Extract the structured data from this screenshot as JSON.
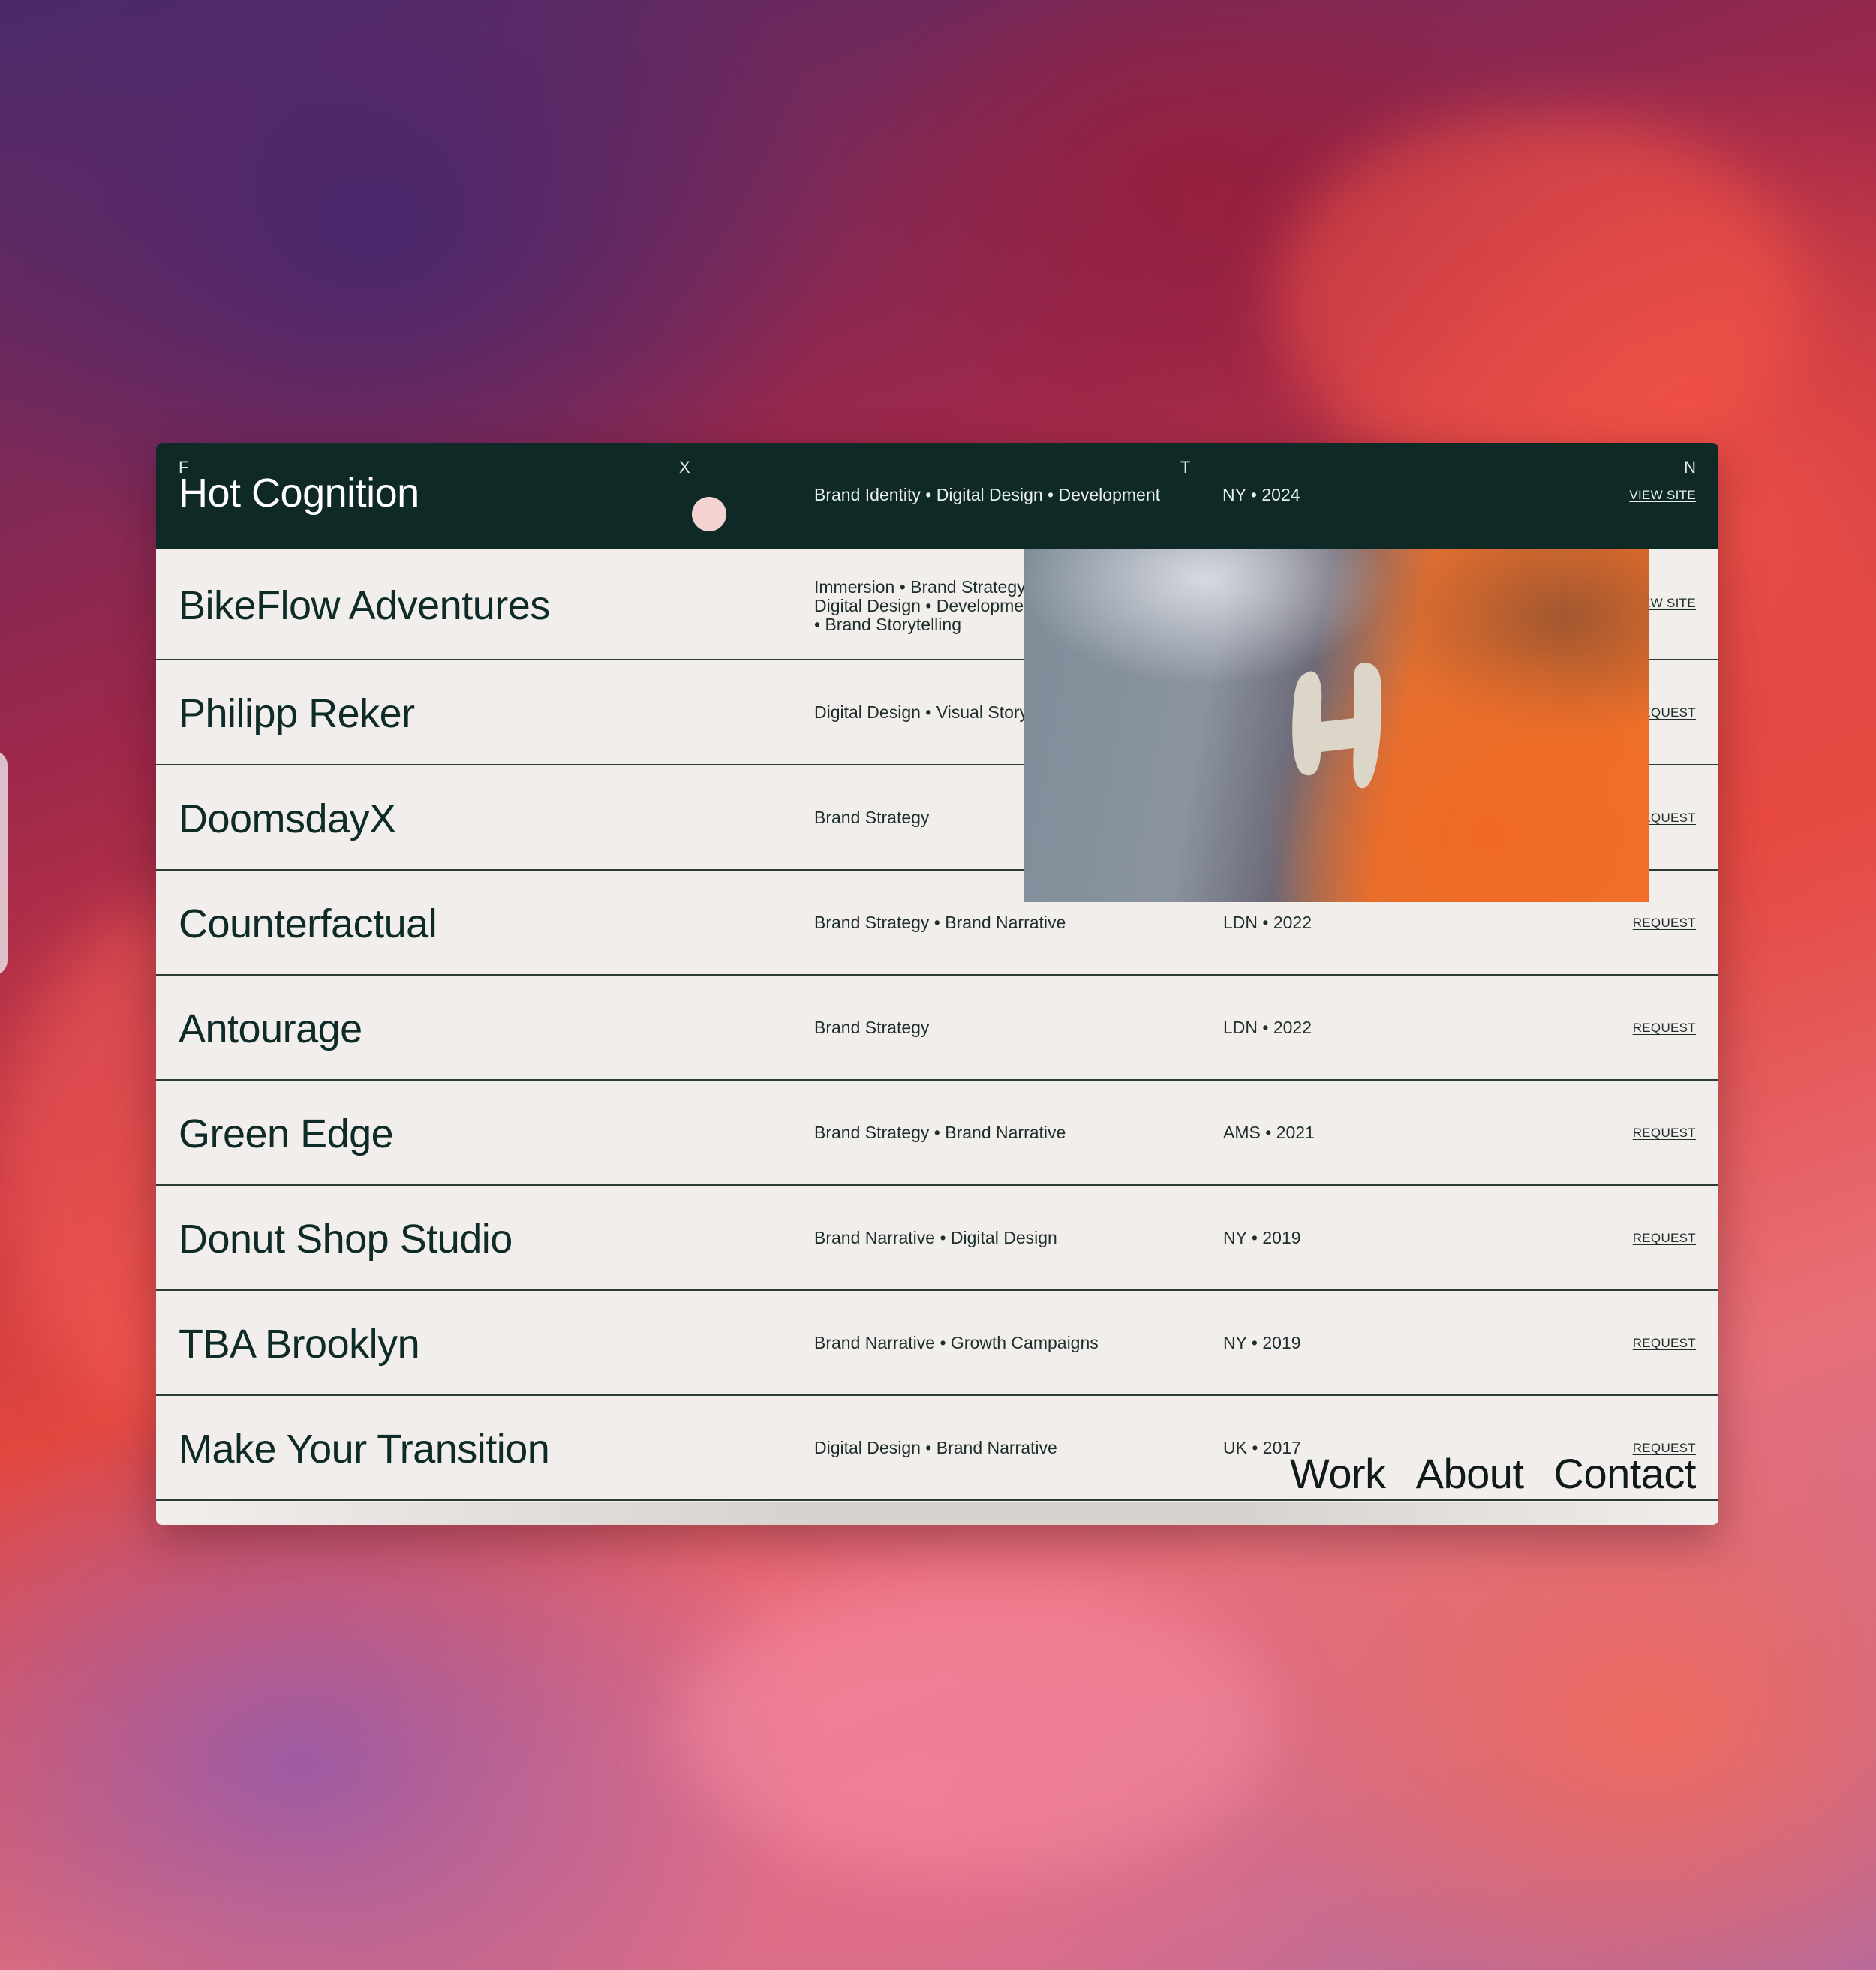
{
  "columns": {
    "a": "F",
    "b": "X",
    "c": "T",
    "d": "N"
  },
  "header_row": {
    "name": "Hot Cognition",
    "services": "Brand Identity • Digital Design • Development",
    "location": "NY • 2024",
    "action": "VIEW SITE"
  },
  "rows": [
    {
      "name": "BikeFlow Adventures",
      "services": "Immersion • Brand Strategy • Digital Design • Development • Brand Storytelling",
      "location": "",
      "action": "VIEW SITE"
    },
    {
      "name": "Philipp Reker",
      "services": "Digital Design • Visual Storytelling",
      "location": "",
      "action": "REQUEST"
    },
    {
      "name": "DoomsdayX",
      "services": "Brand Strategy",
      "location": "",
      "action": "REQUEST"
    },
    {
      "name": "Counterfactual",
      "services": "Brand Strategy • Brand Narrative",
      "location": "LDN • 2022",
      "action": "REQUEST"
    },
    {
      "name": "Antourage",
      "services": "Brand Strategy",
      "location": "LDN • 2022",
      "action": "REQUEST"
    },
    {
      "name": "Green Edge",
      "services": "Brand Strategy • Brand Narrative",
      "location": "AMS • 2021",
      "action": "REQUEST"
    },
    {
      "name": "Donut Shop Studio",
      "services": "Brand Narrative • Digital Design",
      "location": "NY • 2019",
      "action": "REQUEST"
    },
    {
      "name": "TBA Brooklyn",
      "services": "Brand Narrative • Growth Campaigns",
      "location": "NY • 2019",
      "action": "REQUEST"
    },
    {
      "name": "Make Your Transition",
      "services": "Digital Design • Brand Narrative",
      "location": "UK • 2017",
      "action": "REQUEST"
    }
  ],
  "nav": {
    "work": "Work",
    "about": "About",
    "contact": "Contact"
  },
  "colors": {
    "header_bg": "#0f2926",
    "row_bg": "#f1eeeb",
    "dot": "#f5d3d2",
    "preview_accent": "#f06a25"
  }
}
